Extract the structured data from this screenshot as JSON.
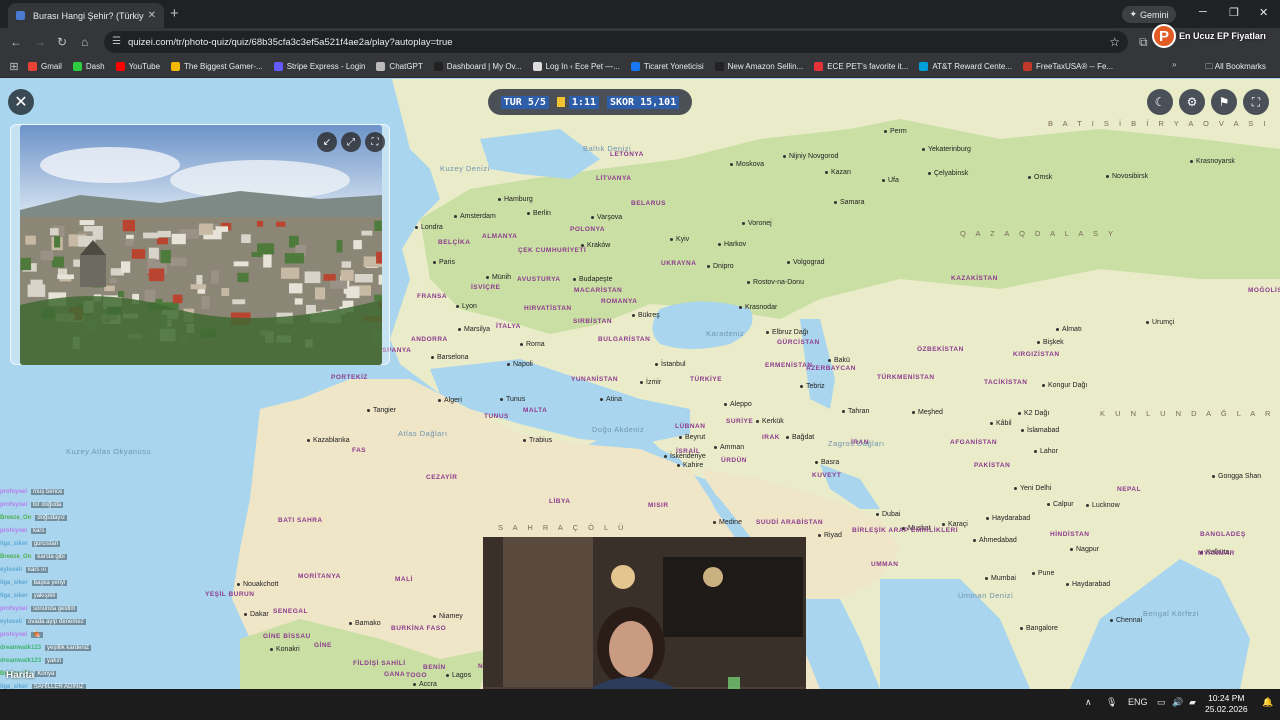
{
  "browser": {
    "tab_title": "Burası Hangi Şehir? (Türkiye) - Q",
    "gemini_label": "Gemini",
    "url": "quizei.com/tr/photo-quiz/quiz/68b35cfa3c3ef5a521f4ae2a/play?autoplay=true",
    "extension_text": "En Ucuz EP Fiyatları"
  },
  "bookmarks": [
    {
      "label": "Gmail",
      "color": "#ea4335"
    },
    {
      "label": "Dash",
      "color": "#2ecc40"
    },
    {
      "label": "YouTube",
      "color": "#ff0000"
    },
    {
      "label": "The Biggest Gamer-...",
      "color": "#f5b800"
    },
    {
      "label": "Stripe Express - Login",
      "color": "#635bff"
    },
    {
      "label": "ChatGPT",
      "color": "#bbbbbb"
    },
    {
      "label": "Dashboard | My Ov...",
      "color": "#222222"
    },
    {
      "label": "Log In ‹ Ece Pet —...",
      "color": "#dddddd"
    },
    {
      "label": "Ticaret Yoneticisi",
      "color": "#1877f2"
    },
    {
      "label": "New Amazon Sellin...",
      "color": "#222222"
    },
    {
      "label": "ECE PET's favorite it...",
      "color": "#e53238"
    },
    {
      "label": "AT&T Reward Cente...",
      "color": "#009fdb"
    },
    {
      "label": "FreeTaxUSA® -- Fe...",
      "color": "#c0392b"
    }
  ],
  "all_bookmarks": "All Bookmarks",
  "quiz": {
    "round": "TUR 5/5",
    "timer": "1:11",
    "score": "SKOR 15,101"
  },
  "map_labels": {
    "cities": [
      [
        "Moskova",
        730,
        82
      ],
      [
        "Nijniy Novgorod",
        783,
        74
      ],
      [
        "Kazan",
        825,
        90
      ],
      [
        "Perm",
        884,
        49
      ],
      [
        "Yekaterinburg",
        922,
        67
      ],
      [
        "Ufa",
        882,
        98
      ],
      [
        "Çelyabinsk",
        928,
        91
      ],
      [
        "Omsk",
        1028,
        95
      ],
      [
        "Novosibirsk",
        1106,
        94
      ],
      [
        "Krasnoyarsk",
        1190,
        79
      ],
      [
        "Samara",
        834,
        120
      ],
      [
        "Voronej",
        742,
        141
      ],
      [
        "Kyiv",
        670,
        157
      ],
      [
        "Harkov",
        718,
        162
      ],
      [
        "Volgograd",
        787,
        180
      ],
      [
        "Dnipro",
        707,
        184
      ],
      [
        "Rostov-na-Donu",
        747,
        200
      ],
      [
        "Krasnodar",
        739,
        225
      ],
      [
        "Hamburg",
        498,
        117
      ],
      [
        "Berlin",
        527,
        131
      ],
      [
        "Amsterdam",
        454,
        134
      ],
      [
        "Londra",
        415,
        145
      ],
      [
        "Varşova",
        591,
        135
      ],
      [
        "Kraków",
        581,
        163
      ],
      [
        "Paris",
        433,
        180
      ],
      [
        "Münih",
        486,
        195
      ],
      [
        "Budapeşte",
        573,
        197
      ],
      [
        "Lyon",
        456,
        224
      ],
      [
        "Bükreş",
        632,
        233
      ],
      [
        "Marsilya",
        458,
        247
      ],
      [
        "Roma",
        520,
        262
      ],
      [
        "Barselona",
        431,
        275
      ],
      [
        "Napoli",
        507,
        282
      ],
      [
        "İstanbul",
        655,
        282
      ],
      [
        "İzmir",
        640,
        300
      ],
      [
        "Atina",
        600,
        317
      ],
      [
        "Tunus",
        500,
        317
      ],
      [
        "Algeri",
        438,
        318
      ],
      [
        "Tahran",
        842,
        329
      ],
      [
        "Bakü",
        828,
        278
      ],
      [
        "Tebriz",
        800,
        304
      ],
      [
        "Aleppo",
        724,
        322
      ],
      [
        "Beyrut",
        679,
        355
      ],
      [
        "Amman",
        714,
        365
      ],
      [
        "Kahire",
        677,
        383
      ],
      [
        "İskenderiye",
        664,
        374
      ],
      [
        "Bağdat",
        786,
        355
      ],
      [
        "Kerkük",
        756,
        339
      ],
      [
        "Basra",
        815,
        380
      ],
      [
        "Meşhed",
        912,
        330
      ],
      [
        "Almatı",
        1056,
        247
      ],
      [
        "Bişkek",
        1037,
        260
      ],
      [
        "Urumçi",
        1146,
        240
      ],
      [
        "Kâbil",
        990,
        341
      ],
      [
        "İslamabad",
        1021,
        348
      ],
      [
        "Lahor",
        1034,
        369
      ],
      [
        "Yeni Delhi",
        1014,
        406
      ],
      [
        "Karaçi",
        942,
        442
      ],
      [
        "Haydarabad",
        986,
        436
      ],
      [
        "Ahmedabad",
        973,
        458
      ],
      [
        "Mumbai",
        985,
        496
      ],
      [
        "Pune",
        1032,
        491
      ],
      [
        "Haydarabad",
        1066,
        502
      ],
      [
        "Kalküta",
        1200,
        470
      ],
      [
        "Lucknow",
        1086,
        423
      ],
      [
        "Calpur",
        1047,
        422
      ],
      [
        "Nagpur",
        1070,
        467
      ],
      [
        "Bangalore",
        1020,
        546
      ],
      [
        "Chennai",
        1110,
        538
      ],
      [
        "Dubai",
        876,
        432
      ],
      [
        "Muskat",
        902,
        446
      ],
      [
        "Riyad",
        818,
        453
      ],
      [
        "Medine",
        713,
        440
      ],
      [
        "Cidde",
        718,
        462
      ],
      [
        "Trabius",
        523,
        358
      ],
      [
        "Kazablanka",
        307,
        358
      ],
      [
        "Tangier",
        367,
        328
      ],
      [
        "Nouakchott",
        237,
        502
      ],
      [
        "Dakar",
        244,
        532
      ],
      [
        "Bamako",
        349,
        541
      ],
      [
        "Niamey",
        433,
        534
      ],
      [
        "Konakri",
        270,
        567
      ],
      [
        "Lagos",
        446,
        593
      ],
      [
        "Accra",
        413,
        602
      ],
      [
        "Elbruz Dağı",
        766,
        250
      ],
      [
        "Kongur Dağı",
        1042,
        303
      ],
      [
        "K2 Dağı",
        1018,
        331
      ],
      [
        "Gongga Shan",
        1212,
        394
      ]
    ],
    "countries": [
      [
        "LETONYA",
        610,
        72
      ],
      [
        "LİTVANYA",
        596,
        96
      ],
      [
        "BELARUS",
        631,
        121
      ],
      [
        "ALMANYA",
        482,
        154
      ],
      [
        "POLONYA",
        570,
        147
      ],
      [
        "ÇEK CUMHURİYETİ",
        518,
        168
      ],
      [
        "UKRAYNA",
        661,
        181
      ],
      [
        "AVUSTURYA",
        517,
        197
      ],
      [
        "MACARİSTAN",
        574,
        208
      ],
      [
        "ROMANYA",
        601,
        219
      ],
      [
        "FRANSA",
        417,
        214
      ],
      [
        "İSVİÇRE",
        471,
        205
      ],
      [
        "HIRVATİSTAN",
        524,
        226
      ],
      [
        "SIRBİSTAN",
        573,
        239
      ],
      [
        "BULGARİSTAN",
        598,
        257
      ],
      [
        "İTALYA",
        496,
        244
      ],
      [
        "ANDORRA",
        411,
        257
      ],
      [
        "YUNANİSTAN",
        571,
        297
      ],
      [
        "TÜRKİYE",
        690,
        297
      ],
      [
        "GÜRCİSTAN",
        777,
        260
      ],
      [
        "ERMENİSTAN",
        765,
        283
      ],
      [
        "AZERBAYCAN",
        806,
        286
      ],
      [
        "KAZAKİSTAN",
        951,
        196
      ],
      [
        "ÖZBEKİSTAN",
        917,
        267
      ],
      [
        "KIRGIZİSTAN",
        1013,
        272
      ],
      [
        "TÜRKMENİSTAN",
        877,
        295
      ],
      [
        "TACİKİSTAN",
        984,
        300
      ],
      [
        "AFGANİSTAN",
        950,
        360
      ],
      [
        "PAKİSTAN",
        974,
        383
      ],
      [
        "HİNDİSTAN",
        1050,
        452
      ],
      [
        "NEPAL",
        1117,
        407
      ],
      [
        "SURİYE",
        726,
        339
      ],
      [
        "IRAK",
        762,
        355
      ],
      [
        "İRAN",
        851,
        360
      ],
      [
        "LÜBNAN",
        675,
        344
      ],
      [
        "İSRAİL",
        676,
        369
      ],
      [
        "ÜRDÜN",
        721,
        378
      ],
      [
        "MISIR",
        648,
        423
      ],
      [
        "LİBYA",
        549,
        419
      ],
      [
        "CEZAYİR",
        426,
        395
      ],
      [
        "TUNUS",
        484,
        334
      ],
      [
        "FAS",
        352,
        368
      ],
      [
        "MALTA",
        523,
        328
      ],
      [
        "SUUDİ ARABİSTAN",
        756,
        440
      ],
      [
        "KUVEYT",
        812,
        393
      ],
      [
        "UMMAN",
        871,
        482
      ],
      [
        "BİRLEŞİK ARAP EMİRLİKLERİ",
        852,
        448
      ],
      [
        "BATI SAHRA",
        278,
        438
      ],
      [
        "MORİTANYA",
        298,
        494
      ],
      [
        "MALİ",
        395,
        497
      ],
      [
        "NİJER",
        497,
        491
      ],
      [
        "SENEGAL",
        273,
        529
      ],
      [
        "BURKİNA FASO",
        391,
        546
      ],
      [
        "GİNE",
        314,
        563
      ],
      [
        "FİLDİŞİ SAHİLİ",
        353,
        581
      ],
      [
        "GANA",
        384,
        592
      ],
      [
        "TOGO",
        406,
        593
      ],
      [
        "BENİN",
        423,
        585
      ],
      [
        "NİJERYA",
        478,
        584
      ],
      [
        "PORTEKİZ",
        331,
        295
      ],
      [
        "BELÇİKA",
        438,
        160
      ],
      [
        "MYANMAR",
        1198,
        471
      ],
      [
        "BANGLADEŞ",
        1200,
        452
      ],
      [
        "GİNE BİSSAU",
        263,
        554
      ],
      [
        "YEŞİL BURUN",
        205,
        512
      ],
      [
        "İSPANYA",
        380,
        268
      ],
      [
        "MOĞOLİSTAN",
        1248,
        208
      ]
    ],
    "seas": [
      [
        "Kuzey Denizi",
        440,
        85
      ],
      [
        "Baltık Denizi",
        583,
        65
      ],
      [
        "Karadeniz",
        706,
        250
      ],
      [
        "Doğu Akdeniz",
        592,
        346
      ],
      [
        "Kuzey Atlas Okyanusu",
        66,
        368
      ],
      [
        "Umman Denizi",
        958,
        512
      ],
      [
        "Bengal Körfezi",
        1143,
        530
      ],
      [
        "Atlas Dağları",
        398,
        350
      ],
      [
        "Zagros Dağları",
        828,
        360
      ]
    ],
    "regions": [
      [
        "Q A Z A Q   D A L A S Y",
        960,
        150
      ],
      [
        "B A T I   S İ B İ R Y A   O V A S I",
        1048,
        40
      ],
      [
        "S A H R A   Ç Ö L Ü",
        498,
        444
      ],
      [
        "K U N L U N   D A Ğ L A R I",
        1100,
        330
      ]
    ]
  },
  "chat": [
    {
      "user": "profsynel",
      "color": "#b77cf0",
      "msg": "muş bence"
    },
    {
      "user": "profsynel",
      "color": "#b77cf0",
      "msg": "bir doğuda"
    },
    {
      "user": "Breeze_On",
      "color": "#4caf50",
      "msg": "doğudayız"
    },
    {
      "user": "profsynel",
      "color": "#b77cf0",
      "msg": "kars"
    },
    {
      "user": "liga_siker",
      "color": "#5fa8d3",
      "msg": "gürcistan"
    },
    {
      "user": "Breeze_On",
      "color": "#4caf50",
      "msg": "karsta gibi"
    },
    {
      "user": "eyloseli",
      "color": "#5fa8d3",
      "msg": "kars ııı"
    },
    {
      "user": "liga_siker",
      "color": "#5fa8d3",
      "msg": "başka yeriyi"
    },
    {
      "user": "liga_siker",
      "color": "#5fa8d3",
      "msg": "yakışıklı"
    },
    {
      "user": "profsynel",
      "color": "#b77cf0",
      "msg": "sonunda geldim"
    },
    {
      "user": "eyloseli",
      "color": "#5fa8d3",
      "msg": "ovada ayıp denemez"
    },
    {
      "user": "profsynel",
      "color": "#b77cf0",
      "msg": "🍖"
    },
    {
      "user": "dreamwalk123",
      "color": "#3cb371",
      "msg": "yeşillik kardeniz"
    },
    {
      "user": "dreamwalk123",
      "color": "#3cb371",
      "msg": "yakın"
    },
    {
      "user": "Breeze_On",
      "color": "#4caf50",
      "msg": "Konya"
    },
    {
      "user": "liga_siker",
      "color": "#5fa8d3",
      "msg": "SAHİLLER ADINIZ"
    },
    {
      "user": "profsynel",
      "color": "#b77cf0",
      "msg": "sinop bence"
    },
    {
      "user": "dreamwalk123",
      "color": "#e05050",
      "msg": "sarmadı be"
    }
  ],
  "harita_label": "Harita",
  "taskbar": {
    "lang": "ENG",
    "time": "10:24 PM",
    "date": "25.02.2026"
  },
  "colors": {
    "water": "#a9d6ee",
    "land": "#e9ebc9",
    "country_label": "#8e3b8e",
    "hud_bg": "#4b5056",
    "highlight": "#2f5ea8"
  }
}
